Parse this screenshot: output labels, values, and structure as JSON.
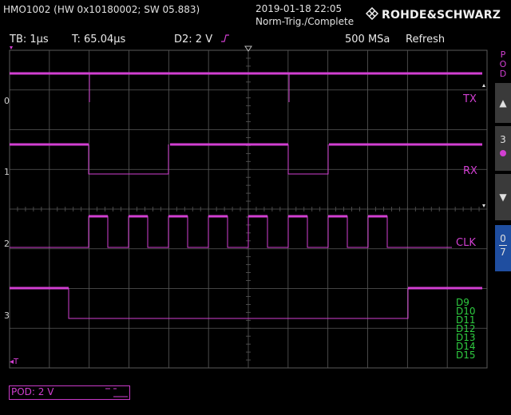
{
  "header": {
    "device": "HMO1002 (HW 0x10180002; SW 05.883)",
    "datetime": "2019-01-18 22:05",
    "trigger_status": "Norm-Trig./Complete",
    "brand": "ROHDE&SCHWARZ"
  },
  "settings": {
    "timebase": "TB: 1µs",
    "trigger_time": "T: 65.04µs",
    "trigger_level": "D2: 2 V",
    "sample_rate": "500 MSa",
    "mode": "Refresh"
  },
  "channel_labels": {
    "tx": "TX",
    "rx": "RX",
    "clk": "CLK",
    "row0": "0",
    "row1": "1",
    "row2": "2",
    "row3": "3",
    "trigger_marker": "T"
  },
  "digital_labels": [
    "D9",
    "D10",
    "D11",
    "D12",
    "D13",
    "D14",
    "D15"
  ],
  "right_panel": {
    "pod_title": "POD",
    "page_number": "3",
    "range_top": "0",
    "range_bottom": "7"
  },
  "footer": {
    "pod_threshold": "POD: 2 V"
  },
  "colors": {
    "trace": "#d23fd2",
    "digital": "#2ecc40",
    "grid": "#5a5a5a",
    "panel": "#3a3a3a",
    "panel_active": "#1f4ea0"
  }
}
